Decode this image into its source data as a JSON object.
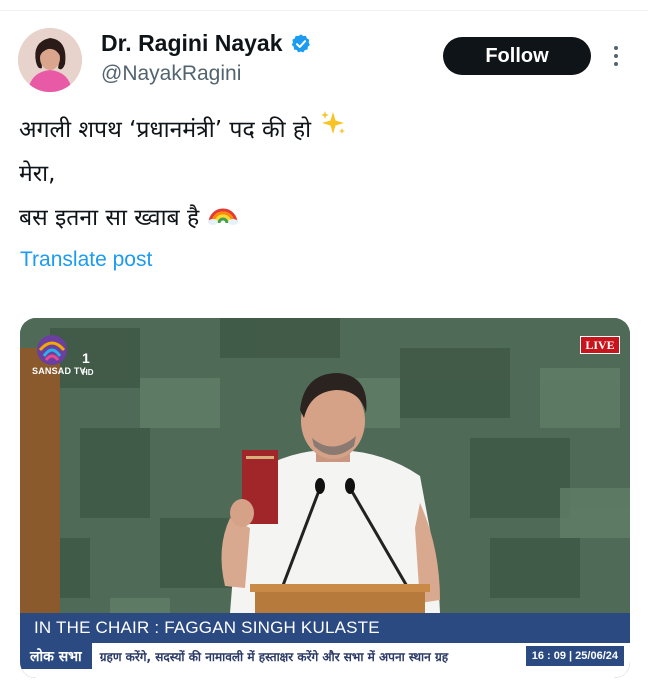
{
  "post": {
    "author": {
      "display_name": "Dr. Ragini Nayak",
      "handle": "@NayakRagini"
    },
    "follow_label": "Follow",
    "lines": [
      "अगली शपथ ‘प्रधानमंत्री’ पद की हो",
      "मेरा,",
      "बस इतना सा ख्वाब है"
    ],
    "emojis": {
      "line1": "✨",
      "line3": "🌈"
    },
    "translate_label": "Translate post",
    "colors": {
      "accent": "#1d9bf0",
      "follow_bg": "#0f1419",
      "text": "#0f1419",
      "secondary": "#536471"
    }
  },
  "video": {
    "channel_logo_text": "SANSAD TV",
    "channel_number": "1",
    "channel_hd": "HD",
    "live_badge": "LIVE",
    "chair_caption": "IN THE CHAIR : FAGGAN SINGH KULASTE",
    "ticker_label": "लोक सभा",
    "ticker_text": "ग्रहण करेंगे, सदस्यों की नामावली में हस्ताक्षर करेंगे और सभा में अपना स्थान ग्रह",
    "ticker_time": "16 : 09 | 25/06/24",
    "colors": {
      "bar": "#2b4a82",
      "live": "#c8141c",
      "wall": "#4e6a55"
    }
  },
  "icons": [
    "verified-badge-icon",
    "more-options-icon",
    "sparkles-emoji",
    "rainbow-emoji",
    "sansad-tv-logo"
  ]
}
